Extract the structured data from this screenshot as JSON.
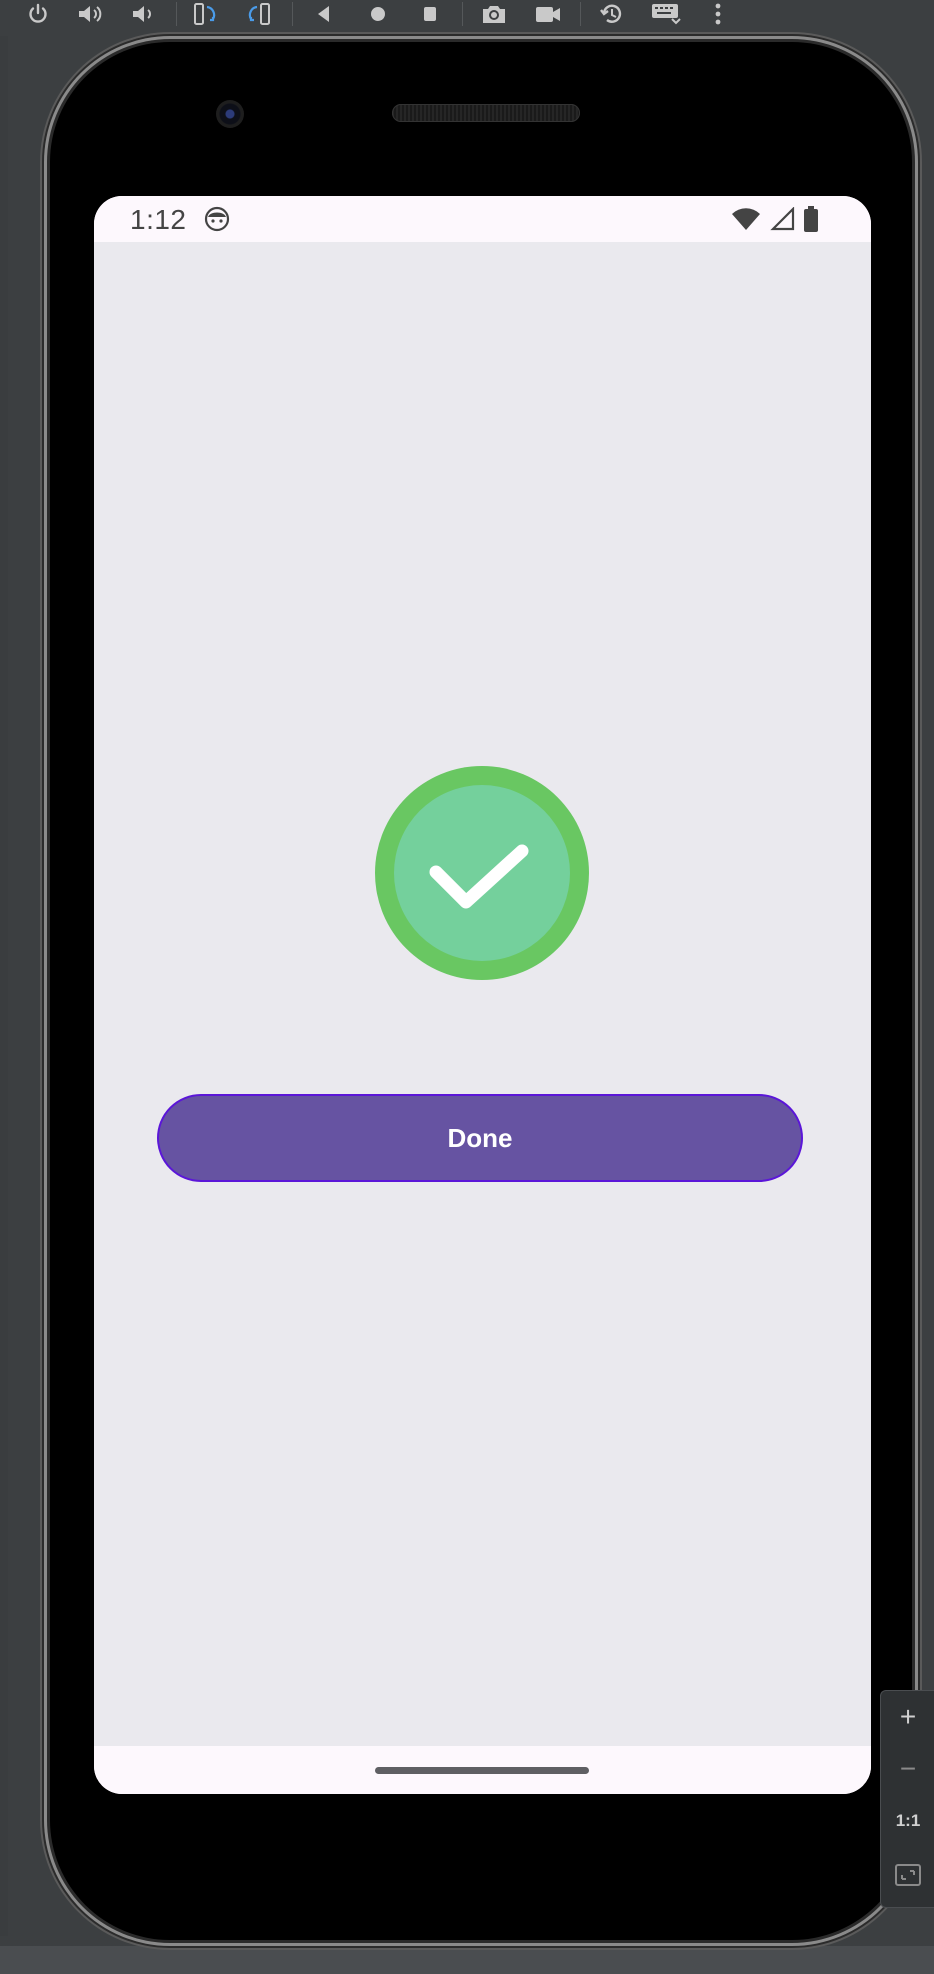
{
  "toolbar": {
    "buttons": [
      {
        "name": "power-icon"
      },
      {
        "name": "volume-up-icon"
      },
      {
        "name": "volume-down-icon"
      },
      {
        "name": "rotate-left-icon"
      },
      {
        "name": "rotate-right-icon"
      },
      {
        "name": "back-icon"
      },
      {
        "name": "home-icon"
      },
      {
        "name": "overview-icon"
      },
      {
        "name": "camera-icon"
      },
      {
        "name": "video-icon"
      },
      {
        "name": "snapshot-restore-icon"
      },
      {
        "name": "keyboard-icon"
      },
      {
        "name": "more-icon"
      }
    ]
  },
  "status_bar": {
    "time": "1:12"
  },
  "main": {
    "done_label": "Done"
  },
  "zoom": {
    "plus": "+",
    "minus": "−",
    "one_to_one": "1:1"
  },
  "colors": {
    "button_fill": "#6653a2",
    "button_border": "#5b16d8",
    "ring_outer": "#69c762",
    "ring_inner": "#74d09c",
    "content_bg": "#eae9ee"
  }
}
